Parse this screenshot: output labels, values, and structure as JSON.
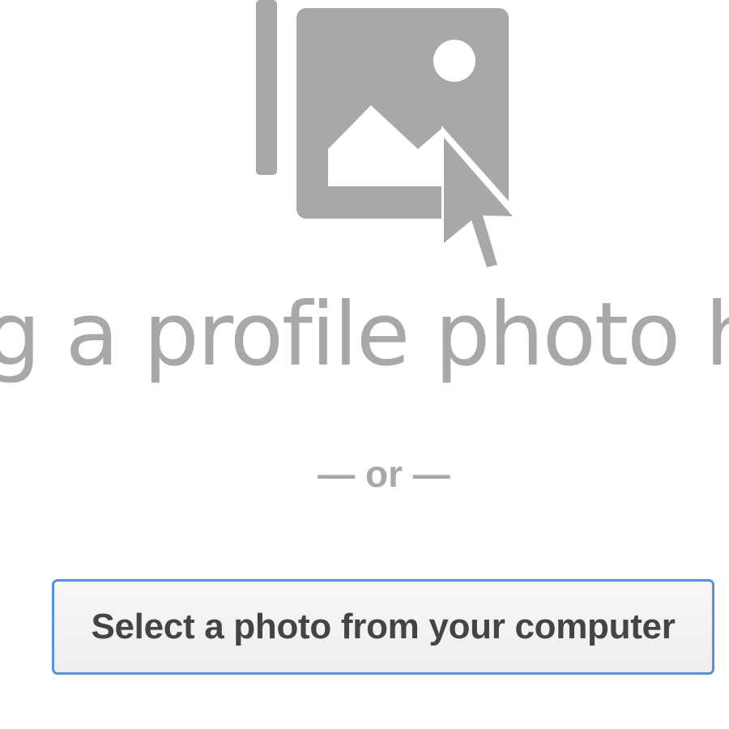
{
  "upload": {
    "icon": "image-upload-icon",
    "drag_text": "Drag a profile photo here",
    "separator": "— or —",
    "select_button_label": "Select a photo from your computer"
  },
  "colors": {
    "icon_gray": "#a8a8a8",
    "text_gray": "#a8a8a8",
    "button_border": "#5a8fe8",
    "button_text": "#444444"
  }
}
